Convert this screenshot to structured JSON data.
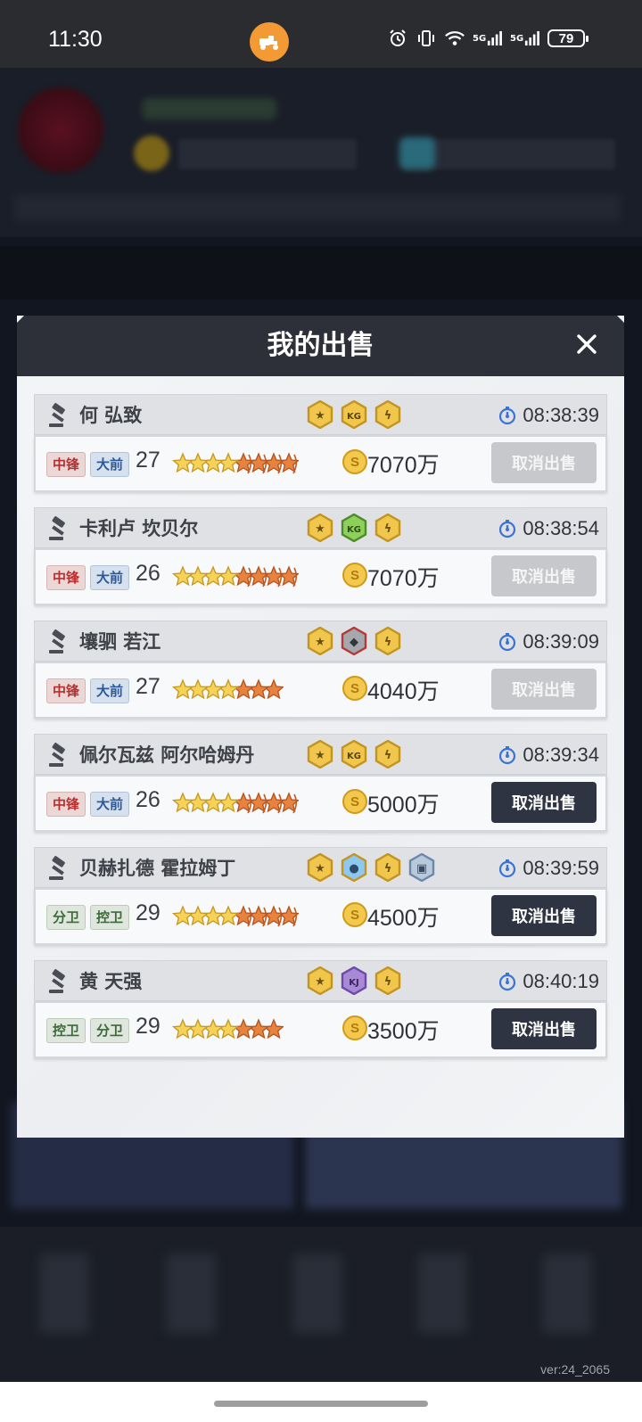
{
  "status_bar": {
    "time": "11:30",
    "battery": "79",
    "signal_labels": [
      "5G",
      "5G"
    ]
  },
  "background": {
    "version": "ver:24_2065"
  },
  "modal": {
    "title": "我的出售",
    "items": [
      {
        "name": "何 弘致",
        "time": "08:38:39",
        "positions": [
          {
            "label": "中锋",
            "color": "red"
          },
          {
            "label": "大前",
            "color": "blue"
          }
        ],
        "age": "27",
        "stars": {
          "gold": 4,
          "bronze": 4,
          "style": "flame"
        },
        "badges": [
          "hexagon-gold-badge",
          "kg-gold-badge",
          "lightning-gold-badge"
        ],
        "price": "7070万",
        "cancel_label": "取消出售",
        "cancel_enabled": false
      },
      {
        "name": "卡利卢 坎贝尔",
        "time": "08:38:54",
        "positions": [
          {
            "label": "中锋",
            "color": "red"
          },
          {
            "label": "大前",
            "color": "blue"
          }
        ],
        "age": "26",
        "stars": {
          "gold": 4,
          "bronze": 4,
          "style": "flame"
        },
        "badges": [
          "hexagon-gold-badge",
          "kg-green-badge",
          "lightning-gold-badge"
        ],
        "price": "7070万",
        "cancel_label": "取消出售",
        "cancel_enabled": false
      },
      {
        "name": "壤驷 若江",
        "time": "08:39:09",
        "positions": [
          {
            "label": "中锋",
            "color": "red"
          },
          {
            "label": "大前",
            "color": "blue"
          }
        ],
        "age": "27",
        "stars": {
          "gold": 4,
          "bronze": 3,
          "style": "plain"
        },
        "badges": [
          "hexagon-gold-badge",
          "wolf-red-badge",
          "lightning-gold-badge"
        ],
        "price": "4040万",
        "cancel_label": "取消出售",
        "cancel_enabled": false
      },
      {
        "name": "佩尔瓦兹 阿尔哈姆丹",
        "time": "08:39:34",
        "positions": [
          {
            "label": "中锋",
            "color": "red"
          },
          {
            "label": "大前",
            "color": "blue"
          }
        ],
        "age": "26",
        "stars": {
          "gold": 4,
          "bronze": 4,
          "style": "flame"
        },
        "badges": [
          "hexagon-gold-badge",
          "kg-gold-badge",
          "lightning-gold-badge"
        ],
        "price": "5000万",
        "cancel_label": "取消出售",
        "cancel_enabled": true
      },
      {
        "name": "贝赫扎德 霍拉姆丁",
        "time": "08:39:59",
        "positions": [
          {
            "label": "分卫",
            "color": "green"
          },
          {
            "label": "控卫",
            "color": "green"
          }
        ],
        "age": "29",
        "stars": {
          "gold": 4,
          "bronze": 4,
          "style": "flame"
        },
        "badges": [
          "hexagon-gold-badge",
          "blue-gold-badge",
          "lightning-gold-badge",
          "gray-blue-badge"
        ],
        "price": "4500万",
        "cancel_label": "取消出售",
        "cancel_enabled": true
      },
      {
        "name": "黄 天强",
        "time": "08:40:19",
        "positions": [
          {
            "label": "控卫",
            "color": "green"
          },
          {
            "label": "分卫",
            "color": "green"
          }
        ],
        "age": "29",
        "stars": {
          "gold": 4,
          "bronze": 3,
          "style": "plain"
        },
        "badges": [
          "hexagon-gold-badge",
          "purple-badge",
          "lightning-gold-badge"
        ],
        "price": "3500万",
        "cancel_label": "取消出售",
        "cancel_enabled": true
      }
    ]
  },
  "colors": {
    "header": "#2d3038",
    "button_active": "#2f3442",
    "button_disabled": "#c6c8cc",
    "gold": "#f2c94c",
    "bronze": "#e07a3c"
  }
}
